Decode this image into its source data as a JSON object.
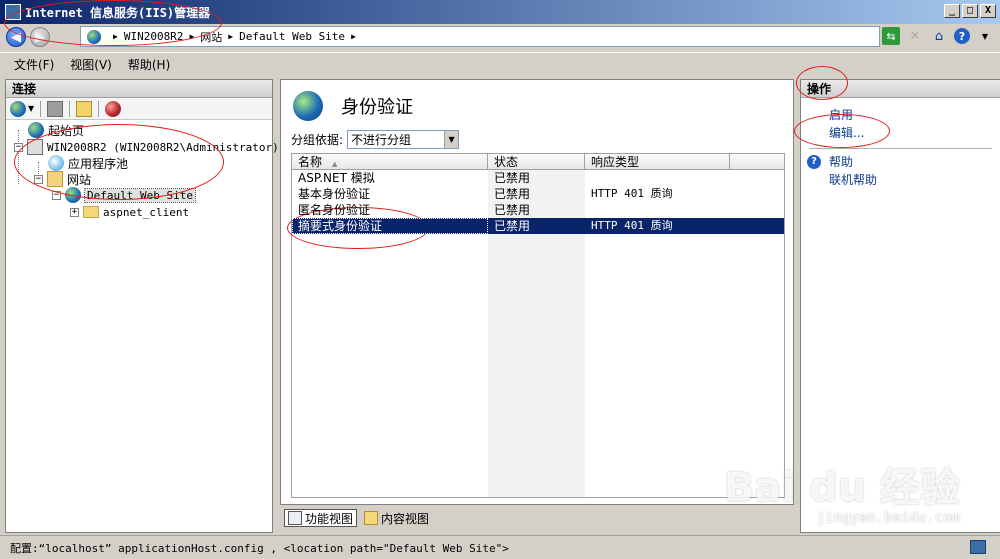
{
  "window": {
    "title": "Internet 信息服务(IIS)管理器",
    "controls": {
      "minimize": "_",
      "maximize": "□",
      "close": "X"
    }
  },
  "address": {
    "breadcrumb": [
      "WIN2008R2",
      "网站",
      "Default Web Site"
    ]
  },
  "menu": [
    "文件(F)",
    "视图(V)",
    "帮助(H)"
  ],
  "connections": {
    "header": "连接",
    "tree": {
      "start_page": "起始页",
      "server": "WIN2008R2 (WIN2008R2\\Administrator)",
      "app_pools": "应用程序池",
      "sites": "网站",
      "default_site": "Default Web Site",
      "aspnet_client": "aspnet_client"
    }
  },
  "feature": {
    "title": "身份验证",
    "group_label": "分组依据:",
    "group_value": "不进行分组",
    "columns": [
      "名称",
      "状态",
      "响应类型"
    ],
    "rows": [
      {
        "name": "ASP.NET 模拟",
        "status": "已禁用",
        "response": ""
      },
      {
        "name": "基本身份验证",
        "status": "已禁用",
        "response": "HTTP 401 质询"
      },
      {
        "name": "匿名身份验证",
        "status": "已禁用",
        "response": ""
      },
      {
        "name": "摘要式身份验证",
        "status": "已禁用",
        "response": "HTTP 401 质询",
        "selected": true
      }
    ],
    "view_tabs": [
      "功能视图",
      "内容视图"
    ]
  },
  "actions": {
    "header": "操作",
    "enable": "启用",
    "edit": "编辑...",
    "help": "帮助",
    "online_help": "联机帮助"
  },
  "status": {
    "text": "配置:“localhost” applicationHost.config , <location path=\"Default Web Site\">"
  },
  "watermark": {
    "brand": "Bai du 经验",
    "url": "jingyan.baidu.com"
  },
  "colors": {
    "title_start": "#0a246a",
    "selection": "#0a246a",
    "link": "#0b3b8c",
    "annotation": "#e41b1b"
  }
}
